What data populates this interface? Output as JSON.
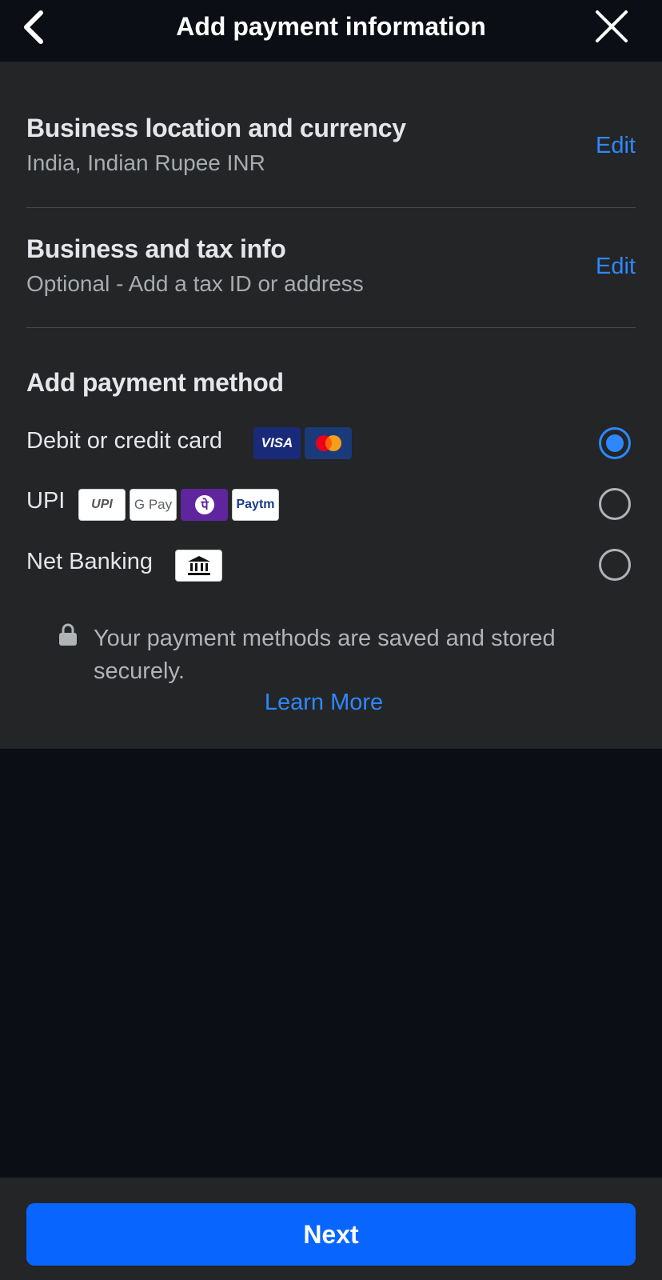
{
  "header": {
    "title": "Add payment information"
  },
  "location_section": {
    "title": "Business location and currency",
    "value": "India, Indian Rupee INR",
    "edit_label": "Edit"
  },
  "tax_section": {
    "title": "Business and tax info",
    "value": "Optional - Add a tax ID or address",
    "edit_label": "Edit"
  },
  "payment_method": {
    "title": "Add payment method",
    "options": [
      {
        "label": "Debit or credit card",
        "logos": [
          "VISA",
          "mastercard-icon"
        ],
        "selected": true
      },
      {
        "label": "UPI",
        "logos": [
          "UPI",
          "G Pay",
          "phonepe-icon",
          "Paytm"
        ],
        "selected": false
      },
      {
        "label": "Net Banking",
        "logos": [
          "bank-icon"
        ],
        "selected": false
      }
    ]
  },
  "security": {
    "note": "Your payment methods are saved and stored securely.",
    "learn_more": "Learn More"
  },
  "footer": {
    "next_label": "Next"
  },
  "colors": {
    "accent": "#2d88ff",
    "button": "#0866ff",
    "panel": "#242526",
    "background": "#0b0e15"
  }
}
